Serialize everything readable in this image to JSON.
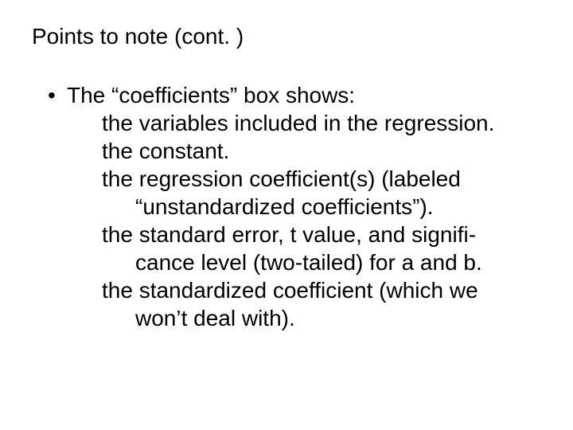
{
  "title": "Points to note (cont. )",
  "bullet": {
    "dot": "•",
    "lead": "The “coefficients” box shows:"
  },
  "lines": {
    "l1": "the variables included in the regression.",
    "l2": "the constant.",
    "l3": "the regression coefficient(s) (labeled",
    "l3c": "“unstandardized coefficients”).",
    "l4": "the standard error, t value, and signifi-",
    "l4c": "cance level (two-tailed) for a and b.",
    "l5": "the standardized coefficient (which we",
    "l5c": "won’t deal with)."
  }
}
